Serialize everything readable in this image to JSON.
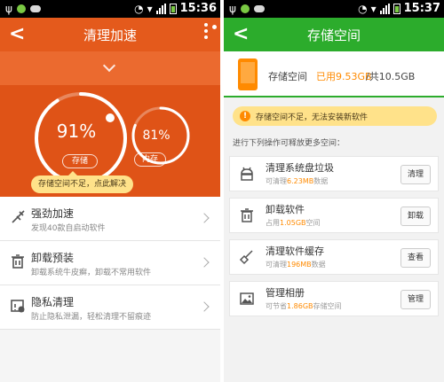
{
  "left": {
    "status": {
      "time": "15:36"
    },
    "header": {
      "back": "<",
      "title": "清理加速"
    },
    "gauge_storage": {
      "value": "91%",
      "label": "存储",
      "level": 0.91
    },
    "gauge_memory": {
      "value": "81%",
      "label": "内存",
      "level": 0.81
    },
    "tip": "存储空间不足，点此解决",
    "rows": [
      {
        "title": "强劲加速",
        "subtitle": "发现40款自启动软件"
      },
      {
        "title": "卸载预装",
        "subtitle": "卸载系统牛皮癣，卸载不常用软件"
      },
      {
        "title": "隐私清理",
        "subtitle": "防止隐私泄漏，轻松清理不留痕迹"
      }
    ]
  },
  "right": {
    "status": {
      "time": "15:37"
    },
    "header": {
      "back": "<",
      "title": "存储空间"
    },
    "storage": {
      "label": "存储空间",
      "used": "已用9.53GB",
      "total": "/共10.5GB"
    },
    "warning": "存储空间不足，无法安装新软件",
    "hint": "进行下列操作可释放更多空间：",
    "rows": [
      {
        "title": "清理系统盘垃圾",
        "sub_pre": "可清理",
        "sub_hl": "6.23MB",
        "sub_post": "数据",
        "button": "清理"
      },
      {
        "title": "卸载软件",
        "sub_pre": "占用",
        "sub_hl": "1.05GB",
        "sub_post": "空间",
        "button": "卸载"
      },
      {
        "title": "清理软件缓存",
        "sub_pre": "可清理",
        "sub_hl": "196MB",
        "sub_post": "数据",
        "button": "查看"
      },
      {
        "title": "管理相册",
        "sub_pre": "可节省",
        "sub_hl": "1.86GB",
        "sub_post": "存储空间",
        "button": "管理"
      }
    ]
  },
  "colors": {
    "orange_header": "#e45a1c",
    "green_header": "#2cac2c",
    "accent_orange": "#ff8a00",
    "tip_yellow": "#ffe28a"
  }
}
